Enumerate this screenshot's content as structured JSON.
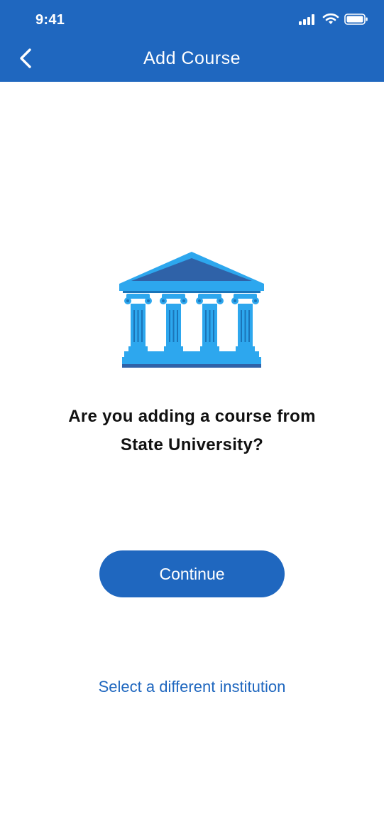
{
  "status_bar": {
    "time": "9:41",
    "icons": [
      "signal-icon",
      "wifi-icon",
      "battery-icon"
    ]
  },
  "nav": {
    "title": "Add Course",
    "back_icon": "chevron-left-icon"
  },
  "illustration": {
    "icon": "institution-building-icon"
  },
  "prompt": {
    "line1": "Are you adding a course from",
    "line2": "State University?"
  },
  "actions": {
    "continue_label": "Continue",
    "alternate_label": "Select a different institution"
  },
  "colors": {
    "primary": "#1f67bf",
    "column_light": "#2da7ee",
    "roof_dark": "#2f62a8"
  }
}
